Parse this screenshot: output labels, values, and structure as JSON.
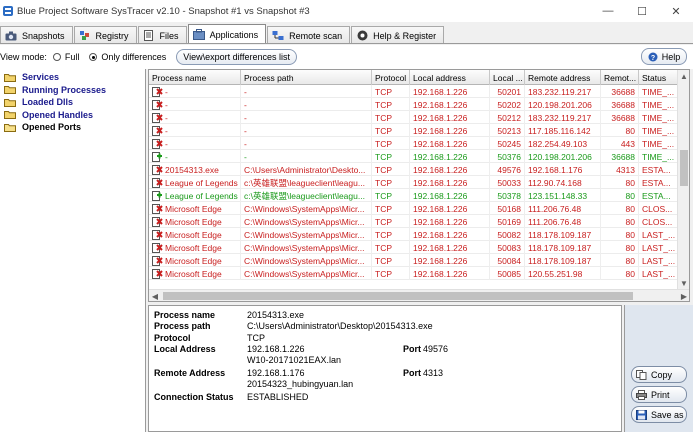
{
  "window": {
    "title": "Blue Project Software SysTracer v2.10 - Snapshot #1 vs Snapshot #3"
  },
  "tabs": [
    {
      "label": "Snapshots",
      "icon": "camera-icon"
    },
    {
      "label": "Registry",
      "icon": "registry-icon"
    },
    {
      "label": "Files",
      "icon": "files-icon"
    },
    {
      "label": "Applications",
      "icon": "applications-icon",
      "active": true
    },
    {
      "label": "Remote scan",
      "icon": "remote-scan-icon"
    },
    {
      "label": "Help & Register",
      "icon": "help-register-icon"
    }
  ],
  "viewbar": {
    "label": "View mode:",
    "full": "Full",
    "only_differences": "Only differences",
    "selected": "Only differences",
    "export_button": "View\\export differences list",
    "help_button": "Help"
  },
  "tree": [
    {
      "label": "Services"
    },
    {
      "label": "Running Processes"
    },
    {
      "label": "Loaded Dlls"
    },
    {
      "label": "Opened Handles"
    },
    {
      "label": "Opened Ports",
      "selected": true
    }
  ],
  "grid": {
    "columns": [
      "Process name",
      "Process path",
      "Protocol",
      "Local address",
      "Local ...",
      "Remote address",
      "Remot...",
      "Status"
    ],
    "rows": [
      {
        "color": "red",
        "name": "-",
        "path": "-",
        "protocol": "TCP",
        "local_address": "192.168.1.226",
        "local_port": "50201",
        "remote_address": "183.232.119.217",
        "remote_port": "36688",
        "status": "TIME_..."
      },
      {
        "color": "red",
        "name": "-",
        "path": "-",
        "protocol": "TCP",
        "local_address": "192.168.1.226",
        "local_port": "50202",
        "remote_address": "120.198.201.206",
        "remote_port": "36688",
        "status": "TIME_..."
      },
      {
        "color": "red",
        "name": "-",
        "path": "-",
        "protocol": "TCP",
        "local_address": "192.168.1.226",
        "local_port": "50212",
        "remote_address": "183.232.119.217",
        "remote_port": "36688",
        "status": "TIME_..."
      },
      {
        "color": "red",
        "name": "-",
        "path": "-",
        "protocol": "TCP",
        "local_address": "192.168.1.226",
        "local_port": "50213",
        "remote_address": "117.185.116.142",
        "remote_port": "80",
        "status": "TIME_..."
      },
      {
        "color": "red",
        "name": "-",
        "path": "-",
        "protocol": "TCP",
        "local_address": "192.168.1.226",
        "local_port": "50245",
        "remote_address": "182.254.49.103",
        "remote_port": "443",
        "status": "TIME_..."
      },
      {
        "color": "green",
        "name": "-",
        "path": "-",
        "protocol": "TCP",
        "local_address": "192.168.1.226",
        "local_port": "50376",
        "remote_address": "120.198.201.206",
        "remote_port": "36688",
        "status": "TIME_..."
      },
      {
        "color": "red",
        "name": "20154313.exe",
        "path": "C:\\Users\\Administrator\\Deskto...",
        "protocol": "TCP",
        "local_address": "192.168.1.226",
        "local_port": "49576",
        "remote_address": "192.168.1.176",
        "remote_port": "4313",
        "status": "ESTA..."
      },
      {
        "color": "red",
        "name": "League of Legends",
        "path": "c:\\英雄联盟\\leagueclient\\leagu...",
        "protocol": "TCP",
        "local_address": "192.168.1.226",
        "local_port": "50033",
        "remote_address": "112.90.74.168",
        "remote_port": "80",
        "status": "ESTA..."
      },
      {
        "color": "green",
        "name": "League of Legends",
        "path": "c:\\英雄联盟\\leagueclient\\leagu...",
        "protocol": "TCP",
        "local_address": "192.168.1.226",
        "local_port": "50378",
        "remote_address": "123.151.148.33",
        "remote_port": "80",
        "status": "ESTA..."
      },
      {
        "color": "red",
        "name": "Microsoft Edge",
        "path": "C:\\Windows\\SystemApps\\Micr...",
        "protocol": "TCP",
        "local_address": "192.168.1.226",
        "local_port": "50168",
        "remote_address": "111.206.76.48",
        "remote_port": "80",
        "status": "CLOS..."
      },
      {
        "color": "red",
        "name": "Microsoft Edge",
        "path": "C:\\Windows\\SystemApps\\Micr...",
        "protocol": "TCP",
        "local_address": "192.168.1.226",
        "local_port": "50169",
        "remote_address": "111.206.76.48",
        "remote_port": "80",
        "status": "CLOS..."
      },
      {
        "color": "red",
        "name": "Microsoft Edge",
        "path": "C:\\Windows\\SystemApps\\Micr...",
        "protocol": "TCP",
        "local_address": "192.168.1.226",
        "local_port": "50082",
        "remote_address": "118.178.109.187",
        "remote_port": "80",
        "status": "LAST_..."
      },
      {
        "color": "red",
        "name": "Microsoft Edge",
        "path": "C:\\Windows\\SystemApps\\Micr...",
        "protocol": "TCP",
        "local_address": "192.168.1.226",
        "local_port": "50083",
        "remote_address": "118.178.109.187",
        "remote_port": "80",
        "status": "LAST_..."
      },
      {
        "color": "red",
        "name": "Microsoft Edge",
        "path": "C:\\Windows\\SystemApps\\Micr...",
        "protocol": "TCP",
        "local_address": "192.168.1.226",
        "local_port": "50084",
        "remote_address": "118.178.109.187",
        "remote_port": "80",
        "status": "LAST_..."
      },
      {
        "color": "red",
        "name": "Microsoft Edge",
        "path": "C:\\Windows\\SystemApps\\Micr...",
        "protocol": "TCP",
        "local_address": "192.168.1.226",
        "local_port": "50085",
        "remote_address": "120.55.251.98",
        "remote_port": "80",
        "status": "LAST_..."
      }
    ]
  },
  "details": {
    "process_name_label": "Process name",
    "process_name": "20154313.exe",
    "process_path_label": "Process path",
    "process_path": "C:\\Users\\Administrator\\Desktop\\20154313.exe",
    "protocol_label": "Protocol",
    "protocol": "TCP",
    "local_address_label": "Local Address",
    "local_address": "192.168.1.226",
    "local_host": "W10-20171021EAX.lan",
    "local_port_label": "Port",
    "local_port": "49576",
    "remote_address_label": "Remote Address",
    "remote_address": "192.168.1.176",
    "remote_host": "20154323_hubingyuan.lan",
    "remote_port_label": "Port",
    "remote_port": "4313",
    "status_label": "Connection Status",
    "status": "ESTABLISHED"
  },
  "side_buttons": {
    "copy": "Copy",
    "print": "Print",
    "save_as": "Save as"
  },
  "colors": {
    "removed": "#c81e1e",
    "added": "#1a9a1a"
  }
}
